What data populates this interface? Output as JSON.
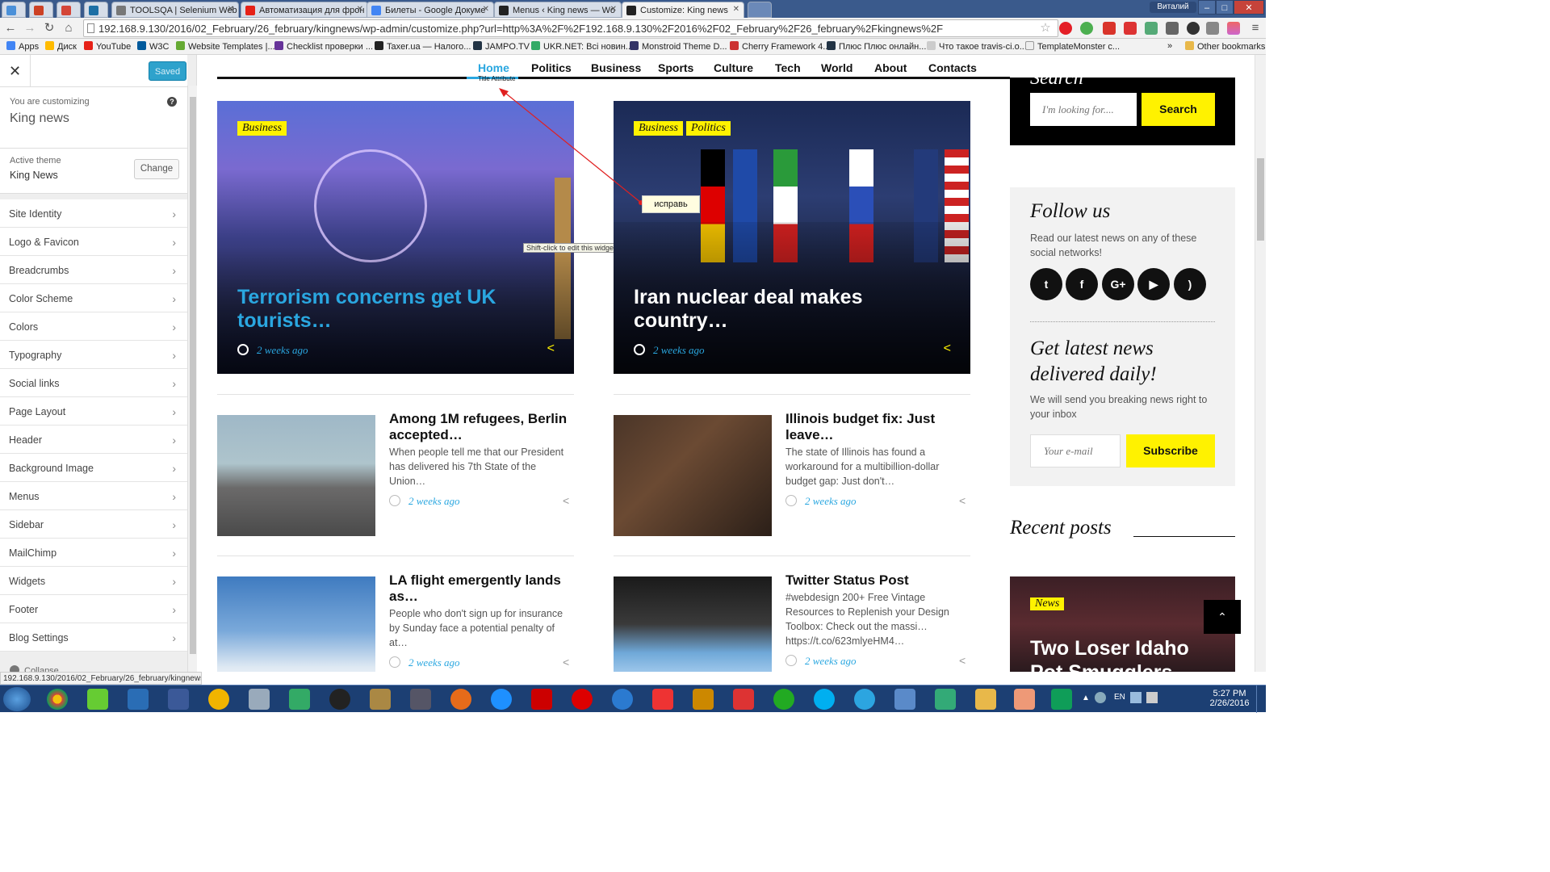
{
  "browser": {
    "tabs": [
      {
        "label": "",
        "color": "#4a90d9"
      },
      {
        "label": "",
        "color": "#cc4125"
      },
      {
        "label": "",
        "color": "#d44638"
      },
      {
        "label": "",
        "color": "#1d6fa5"
      },
      {
        "label": "TOOLSQA | Selenium Web",
        "color": "#777777"
      },
      {
        "label": "Автоматизация для фрон",
        "color": "#e62117"
      },
      {
        "label": "Билеты - Google Докуме",
        "color": "#4285f4"
      },
      {
        "label": "Menus ‹ King news — Wo",
        "color": "#222222"
      },
      {
        "label": "Customize: King news",
        "color": "#222222"
      }
    ],
    "user_label": "Виталий",
    "url": "192.168.9.130/2016/02_February/26_february/kingnews/wp-admin/customize.php?url=http%3A%2F%2F192.168.9.130%2F2016%2F02_February%2F26_february%2Fkingnews%2F",
    "bookmarks": [
      "Apps",
      "Диск",
      "YouTube",
      "W3C",
      "Website Templates |...",
      "Checklist проверки ...",
      "Taxer.ua — Налого...",
      "JAMPO.TV",
      "UKR.NET: Всі новин...",
      "Monstroid Theme D...",
      "Cherry Framework 4...",
      "Плюс Плюс онлайн...",
      "Что такое travis-ci.o...",
      "TemplateMonster с..."
    ],
    "other_bookmarks": "Other bookmarks",
    "status_url": "192.168.9.130/2016/02_February/26_february/kingnews/"
  },
  "customizer": {
    "close_glyph": "✕",
    "saved_label": "Saved",
    "customizing_label": "You are customizing",
    "site_name": "King news",
    "help_glyph": "?",
    "active_theme_label": "Active theme",
    "theme_name": "King News",
    "change_label": "Change",
    "sections": [
      "Site Identity",
      "Logo & Favicon",
      "Breadcrumbs",
      "Color Scheme",
      "Colors",
      "Typography",
      "Social links",
      "Page Layout",
      "Header",
      "Background Image",
      "Menus",
      "Sidebar",
      "MailChimp",
      "Widgets",
      "Footer",
      "Blog Settings"
    ],
    "collapse_label": "Collapse"
  },
  "site": {
    "nav": [
      "Home",
      "Politics",
      "Business",
      "Sports",
      "Culture",
      "Tech",
      "World",
      "About",
      "Contacts"
    ],
    "title_attr_tooltip": "Title Attribute",
    "annotation_note": "исправь",
    "widget_hint": "Shift-click to edit this widget.",
    "featured": [
      {
        "tags": [
          "Business"
        ],
        "title": "Terrorism concerns get UK tourists…",
        "date": "2 weeks ago",
        "title_color": "#2aa7e0"
      },
      {
        "tags": [
          "Business",
          "Politics"
        ],
        "title": "Iran nuclear deal makes country…",
        "date": "2 weeks ago",
        "title_color": "#ffffff"
      }
    ],
    "posts": [
      {
        "title": "Among 1M refugees, Berlin accepted…",
        "excerpt": "When people tell me that our President has delivered his 7th State of the Union…",
        "date": "2 weeks ago"
      },
      {
        "title": "Illinois budget fix: Just leave…",
        "excerpt": "The state of Illinois has found a workaround for a multibillion-dollar budget gap: Just don't…",
        "date": "2 weeks ago"
      },
      {
        "title": "LA flight emergently lands as…",
        "excerpt": "People who don't sign up for insurance by Sunday face a potential penalty of at…",
        "date": "2 weeks ago"
      },
      {
        "title": "Twitter Status Post",
        "excerpt": "#webdesign 200+ Free Vintage Resources to Replenish your Design Toolbox: Check out the massi… https://t.co/623mlyeHM4…",
        "date": "2 weeks ago"
      }
    ],
    "search": {
      "heading": "Search",
      "placeholder": "I'm looking for....",
      "button": "Search"
    },
    "follow": {
      "heading": "Follow us",
      "text": "Read our latest news on any of these social networks!",
      "networks": [
        "twitter",
        "facebook",
        "google-plus",
        "youtube",
        "rss"
      ],
      "glyphs": [
        "t",
        "f",
        "G+",
        "▶",
        ")"
      ]
    },
    "newsletter": {
      "heading": "Get latest news delivered daily!",
      "text": "We will send you breaking news right to your inbox",
      "placeholder": "Your e-mail",
      "button": "Subscribe"
    },
    "recent": {
      "heading": "Recent posts",
      "tag": "News",
      "title": "Two Loser Idaho Pot Smugglers"
    }
  },
  "taskbar": {
    "time": "5:27 PM",
    "date": "2/26/2016",
    "lang": "EN"
  },
  "colors": {
    "accent_yellow": "#fff200",
    "link_blue": "#2aa7e0",
    "wp_blue": "#2ea2cc"
  }
}
